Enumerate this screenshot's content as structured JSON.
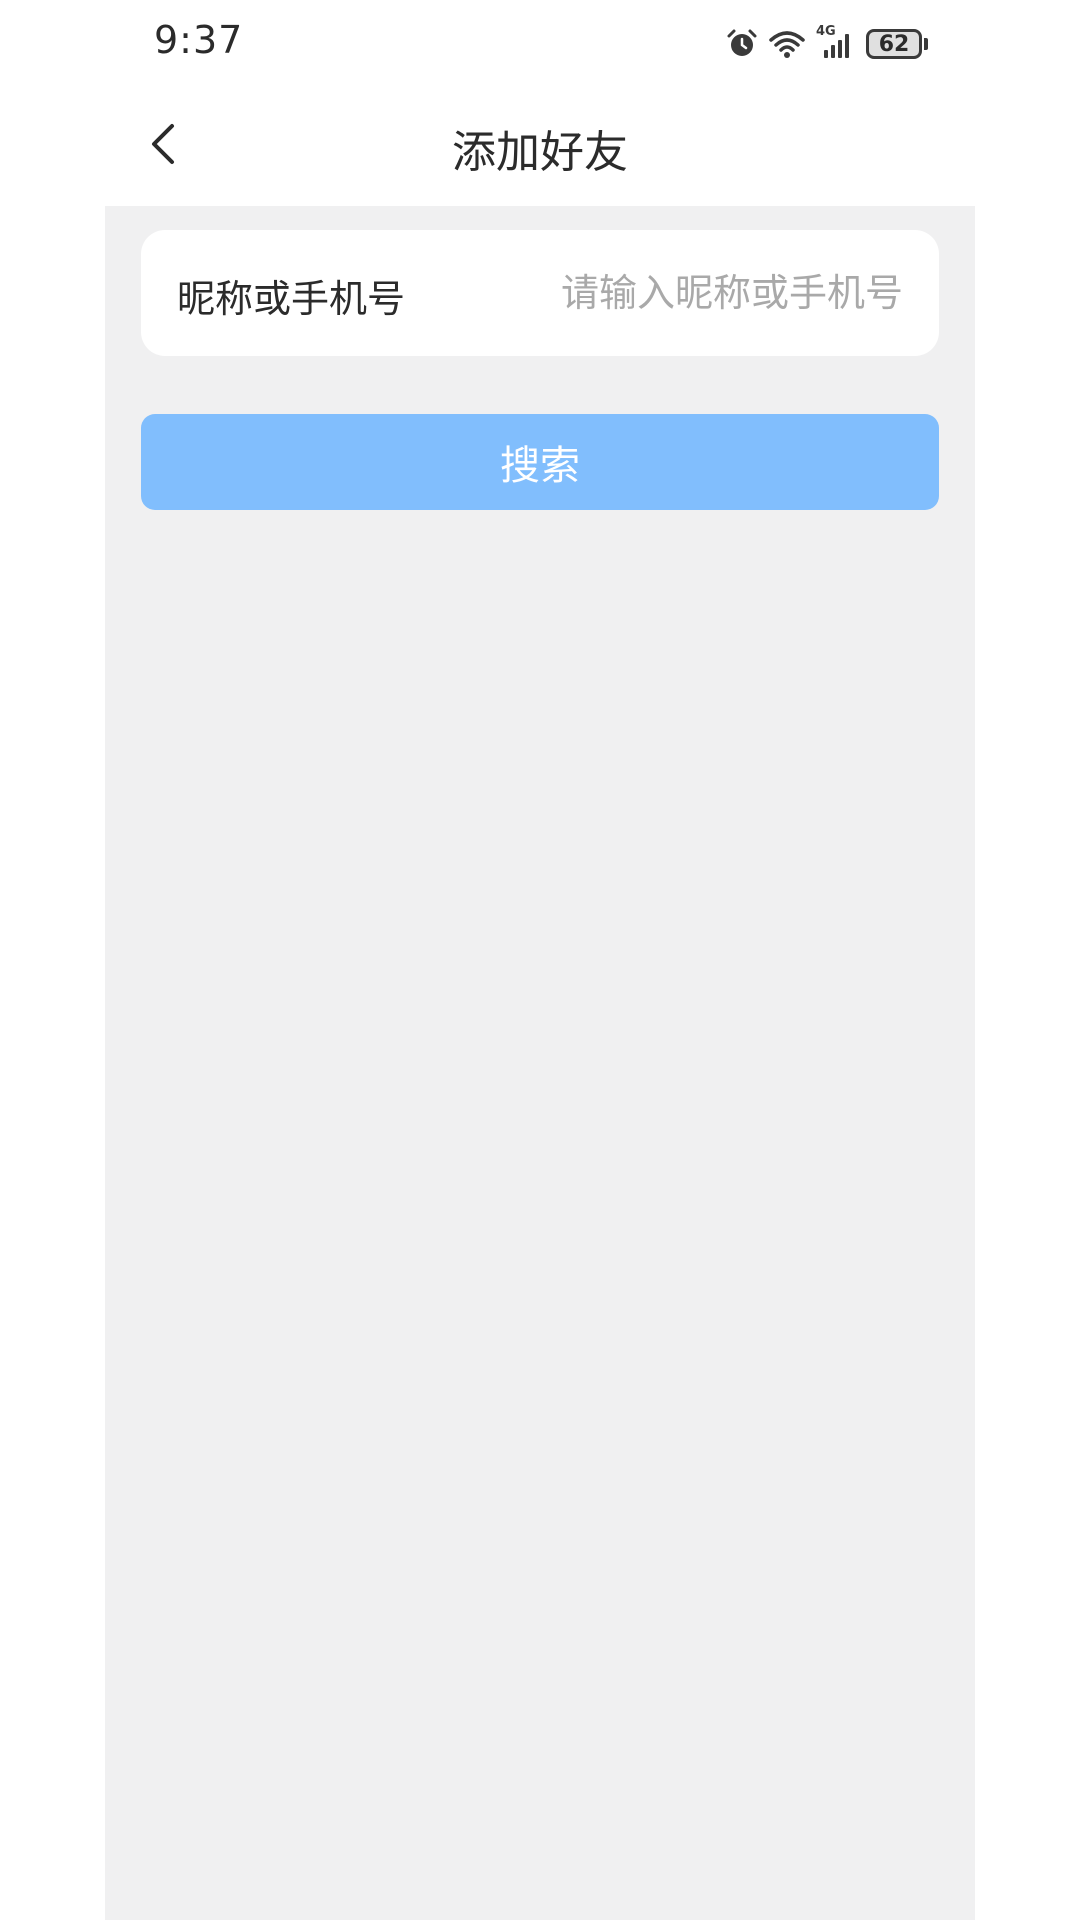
{
  "status_bar": {
    "time": "9:37",
    "network": "4G",
    "battery": "62",
    "icons": [
      "alarm-icon",
      "wifi-icon",
      "signal-icon",
      "battery-icon"
    ]
  },
  "nav": {
    "title": "添加好友",
    "back_icon": "chevron-left-icon"
  },
  "form": {
    "label": "昵称或手机号",
    "placeholder": "请输入昵称或手机号",
    "value": ""
  },
  "search_button": {
    "label": "搜索"
  },
  "colors": {
    "background": "#f0f0f1",
    "card": "#ffffff",
    "primary_button": "#81befd",
    "text": "#2b2b2b",
    "placeholder": "#a9a9a9"
  }
}
